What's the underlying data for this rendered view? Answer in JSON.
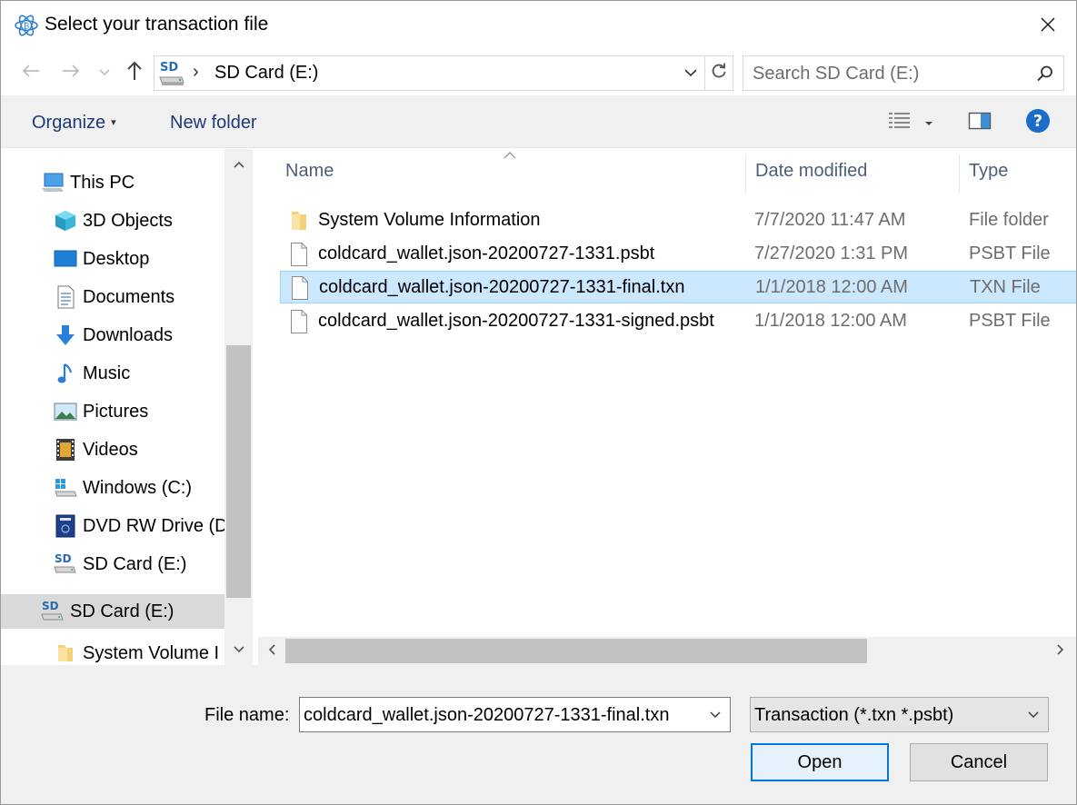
{
  "window": {
    "title": "Select your transaction file",
    "close_icon": "close-icon"
  },
  "nav": {
    "back_icon": "arrow-left-icon",
    "forward_icon": "arrow-right-icon",
    "recent_icon": "chevron-down-icon",
    "up_icon": "arrow-up-icon",
    "address": {
      "separator": "›",
      "location": "SD Card (E:)"
    },
    "search": {
      "placeholder": "Search SD Card (E:)",
      "value": ""
    }
  },
  "toolbar": {
    "organize_label": "Organize",
    "new_folder_label": "New folder",
    "caret": "▾"
  },
  "sidebar": {
    "items": [
      {
        "label": "This PC",
        "icon": "computer-icon"
      },
      {
        "label": "3D Objects",
        "icon": "cube-icon"
      },
      {
        "label": "Desktop",
        "icon": "desktop-icon"
      },
      {
        "label": "Documents",
        "icon": "document-icon"
      },
      {
        "label": "Downloads",
        "icon": "download-icon"
      },
      {
        "label": "Music",
        "icon": "music-icon"
      },
      {
        "label": "Pictures",
        "icon": "picture-icon"
      },
      {
        "label": "Videos",
        "icon": "video-icon"
      },
      {
        "label": "Windows (C:)",
        "icon": "windows-drive-icon"
      },
      {
        "label": "DVD RW Drive (D",
        "icon": "dvd-drive-icon"
      },
      {
        "label": "SD Card (E:)",
        "icon": "sd-card-icon"
      },
      {
        "label": "SD Card (E:)",
        "icon": "sd-card-icon",
        "selected": true
      },
      {
        "label": "System Volume I",
        "icon": "folder-icon"
      }
    ]
  },
  "file_list": {
    "columns": [
      "Name",
      "Date modified",
      "Type"
    ],
    "rows": [
      {
        "name": "System Volume Information",
        "date": "7/7/2020 11:47 AM",
        "type": "File folder",
        "icon": "folder-icon"
      },
      {
        "name": "coldcard_wallet.json-20200727-1331.psbt",
        "date": "7/27/2020 1:31 PM",
        "type": "PSBT File",
        "icon": "file-icon"
      },
      {
        "name": "coldcard_wallet.json-20200727-1331-final.txn",
        "date": "1/1/2018 12:00 AM",
        "type": "TXN File",
        "icon": "file-icon",
        "selected": true
      },
      {
        "name": "coldcard_wallet.json-20200727-1331-signed.psbt",
        "date": "1/1/2018 12:00 AM",
        "type": "PSBT File",
        "icon": "file-icon"
      }
    ]
  },
  "footer": {
    "file_name_label": "File name:",
    "file_name_value": "coldcard_wallet.json-20200727-1331-final.txn",
    "filter_value": "Transaction (*.txn *.psbt)",
    "open_label": "Open",
    "cancel_label": "Cancel"
  },
  "colors": {
    "accent": "#0078d7",
    "selection": "#cce8ff",
    "link": "#1e3a78"
  }
}
